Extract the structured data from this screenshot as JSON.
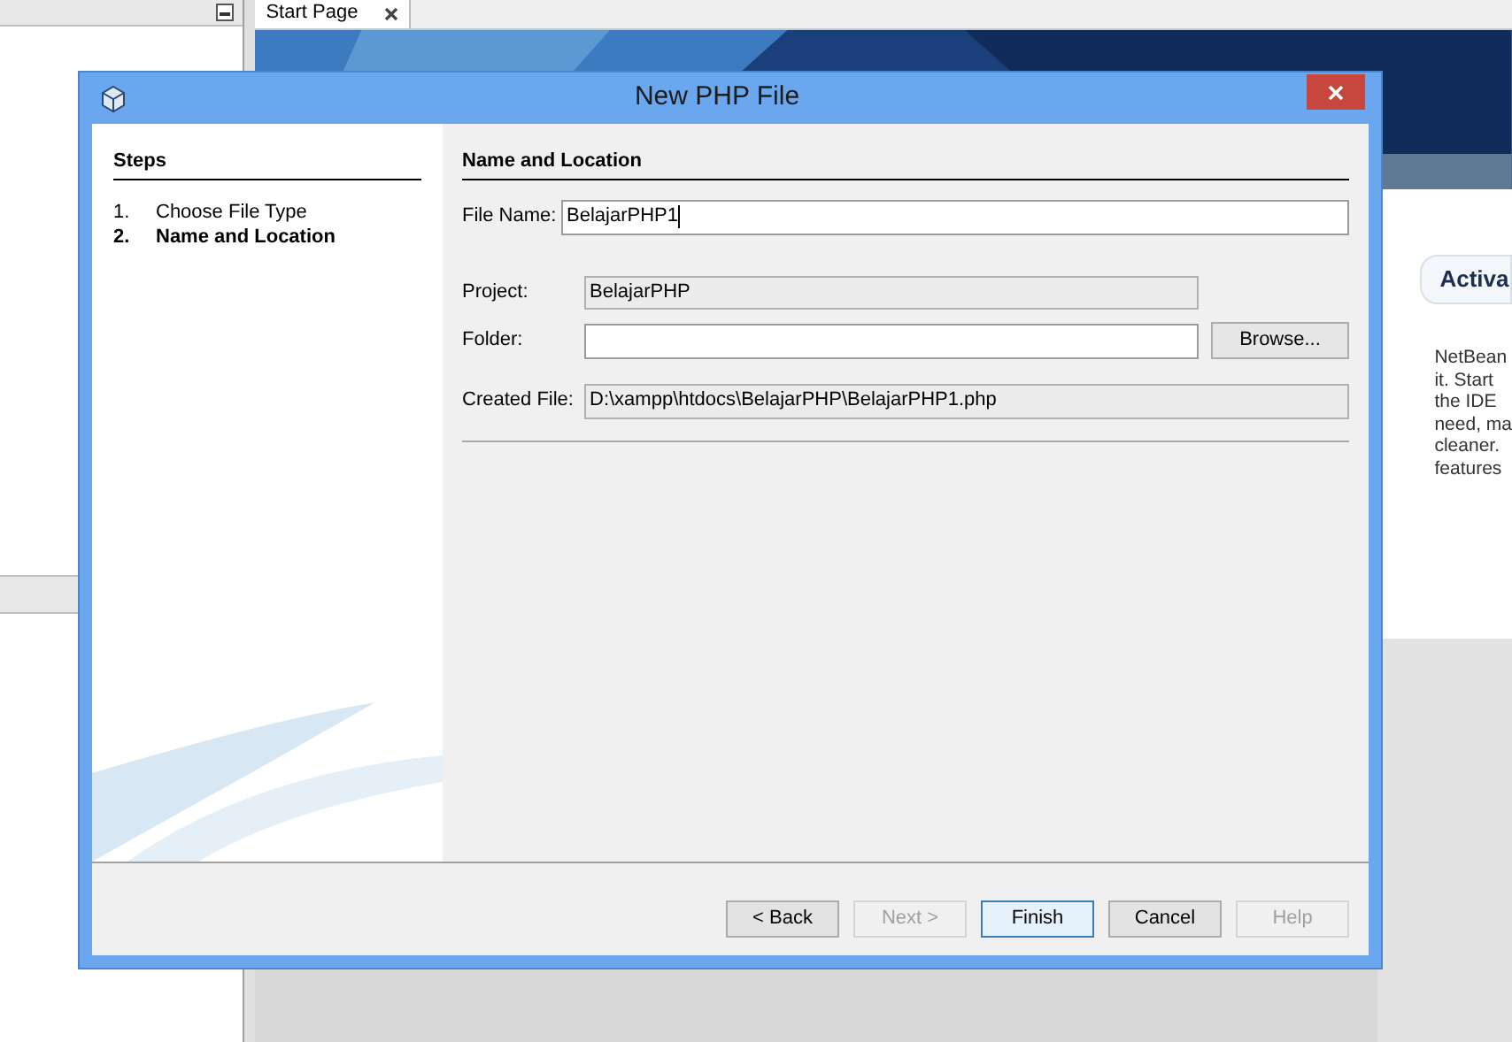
{
  "ide": {
    "start_tab": {
      "label": "Start Page",
      "selected": true
    },
    "start_page": {
      "section_button": "Activa",
      "text_lines": [
        "NetBean",
        "it. Start",
        "the IDE",
        "need, ma",
        "cleaner.",
        "features"
      ]
    }
  },
  "dialog": {
    "title": "New PHP File",
    "steps": {
      "heading": "Steps",
      "items": [
        {
          "number": "1.",
          "label": "Choose File Type",
          "selected": false
        },
        {
          "number": "2.",
          "label": "Name and Location",
          "selected": true
        }
      ]
    },
    "panel": {
      "heading": "Name and Location",
      "file_name": {
        "label": "File Name:",
        "value": "BelajarPHP1"
      },
      "project": {
        "label": "Project:",
        "value": "BelajarPHP"
      },
      "folder": {
        "label": "Folder:",
        "browse": "Browse..."
      },
      "created_file": {
        "label": "Created File:",
        "value": "D:\\xampp\\htdocs\\BelajarPHP\\BelajarPHP1.php"
      }
    },
    "buttons": [
      {
        "label": "< Back",
        "disabled": false,
        "default": false
      },
      {
        "label": "Next >",
        "disabled": true,
        "default": false
      },
      {
        "label": "Finish",
        "disabled": false,
        "default": true
      },
      {
        "label": "Cancel",
        "disabled": false,
        "default": false
      },
      {
        "label": "Help",
        "disabled": true,
        "default": false
      }
    ]
  }
}
